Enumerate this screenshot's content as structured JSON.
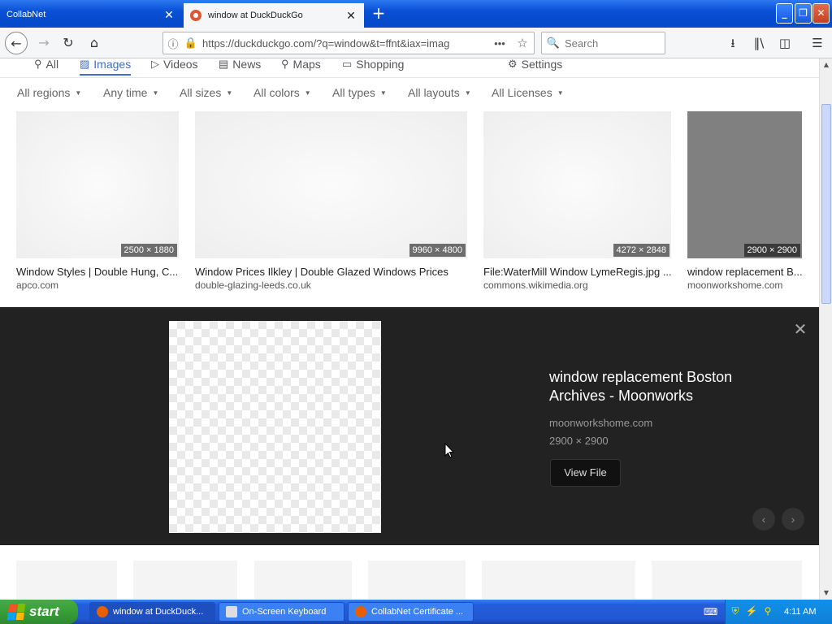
{
  "browser": {
    "tabs": [
      {
        "label": "CollabNet",
        "active": false
      },
      {
        "label": "window at DuckDuckGo",
        "active": true
      }
    ],
    "url": "https://duckduckgo.com/?q=window&t=ffnt&iax=imag",
    "search_placeholder": "Search"
  },
  "search_nav": {
    "items": [
      {
        "label": "All",
        "icon": "search-icon"
      },
      {
        "label": "Images",
        "icon": "image-icon",
        "active": true
      },
      {
        "label": "Videos",
        "icon": "video-icon"
      },
      {
        "label": "News",
        "icon": "news-icon"
      },
      {
        "label": "Maps",
        "icon": "map-pin-icon"
      },
      {
        "label": "Shopping",
        "icon": "shopping-icon"
      }
    ],
    "settings": "Settings"
  },
  "filters": [
    "All regions",
    "Any time",
    "All sizes",
    "All colors",
    "All types",
    "All layouts",
    "All Licenses"
  ],
  "results": [
    {
      "dims": "2500 × 1880",
      "title": "Window Styles | Double Hung, C...",
      "domain": "apco.com"
    },
    {
      "dims": "9960 × 4800",
      "title": "Window Prices Ilkley | Double Glazed Windows Prices",
      "domain": "double-glazing-leeds.co.uk"
    },
    {
      "dims": "4272 × 2848",
      "title": "File:WaterMill Window LymeRegis.jpg ...",
      "domain": "commons.wikimedia.org"
    },
    {
      "dims": "2900 × 2900",
      "title": "window replacement B...",
      "domain": "moonworkshome.com"
    }
  ],
  "detail": {
    "title": "window replacement Boston Archives - Moonworks",
    "domain": "moonworkshome.com",
    "size": "2900 × 2900",
    "view_button": "View File"
  },
  "taskbar": {
    "start": "start",
    "tasks": [
      {
        "label": "window at DuckDuck...",
        "active": true
      },
      {
        "label": "On-Screen Keyboard",
        "active": false
      },
      {
        "label": "CollabNet Certificate ...",
        "active": false
      }
    ],
    "clock": "4:11 AM"
  },
  "colors": {
    "accent": "#3f6ec9",
    "detail_bg": "#222222",
    "xp_blue": "#245edb",
    "start_green": "#39a23a"
  }
}
